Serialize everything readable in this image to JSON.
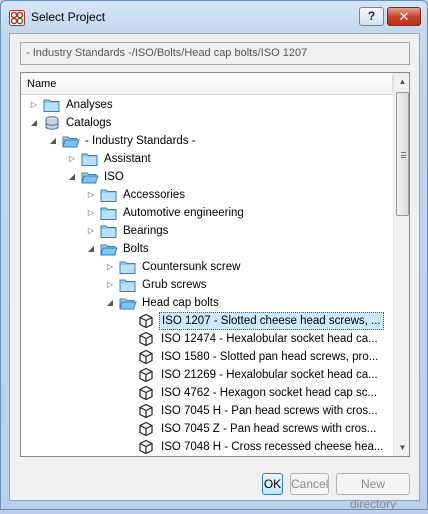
{
  "window": {
    "title": "Select Project",
    "help_label": "?",
    "close_label": "✕"
  },
  "path_field": {
    "value": "- Industry Standards -/ISO/Bolts/Head cap bolts/ISO 1207"
  },
  "tree": {
    "column_header": "Name",
    "rows": [
      {
        "label": "Analyses",
        "expander": "collapsed",
        "icon": "folder-icon"
      },
      {
        "label": "Catalogs",
        "expander": "expanded",
        "icon": "database-icon"
      },
      {
        "label": "- Industry Standards -",
        "expander": "expanded",
        "icon": "folder-open-icon"
      },
      {
        "label": "Assistant",
        "expander": "collapsed",
        "icon": "folder-icon"
      },
      {
        "label": "ISO",
        "expander": "expanded",
        "icon": "folder-open-icon"
      },
      {
        "label": "Accessories",
        "expander": "collapsed",
        "icon": "folder-icon"
      },
      {
        "label": "Automotive engineering",
        "expander": "collapsed",
        "icon": "folder-icon"
      },
      {
        "label": "Bearings",
        "expander": "collapsed",
        "icon": "folder-icon"
      },
      {
        "label": "Bolts",
        "expander": "expanded",
        "icon": "folder-open-icon"
      },
      {
        "label": "Countersunk screw",
        "expander": "collapsed",
        "icon": "folder-icon"
      },
      {
        "label": "Grub screws",
        "expander": "collapsed",
        "icon": "folder-icon"
      },
      {
        "label": "Head cap bolts",
        "expander": "expanded",
        "icon": "folder-open-icon"
      },
      {
        "label": "ISO 1207 - Slotted cheese head screws, ...",
        "expander": "none",
        "icon": "cube-icon",
        "selected": true
      },
      {
        "label": "ISO 12474 - Hexalobular socket head ca...",
        "expander": "none",
        "icon": "cube-icon"
      },
      {
        "label": "ISO 1580 - Slotted pan head screws, pro...",
        "expander": "none",
        "icon": "cube-icon"
      },
      {
        "label": "ISO 21269 - Hexalobular socket head ca...",
        "expander": "none",
        "icon": "cube-icon"
      },
      {
        "label": "ISO 4762 - Hexagon socket head cap sc...",
        "expander": "none",
        "icon": "cube-icon"
      },
      {
        "label": "ISO 7045 H - Pan head screws with cros...",
        "expander": "none",
        "icon": "cube-icon"
      },
      {
        "label": "ISO 7045 Z - Pan head screws with cros...",
        "expander": "none",
        "icon": "cube-icon"
      },
      {
        "label": "ISO 7048 H - Cross recessed cheese hea...",
        "expander": "none",
        "icon": "cube-icon"
      }
    ]
  },
  "buttons": {
    "ok": "OK",
    "cancel": "Cancel",
    "new_directory": "New directory"
  },
  "colors": {
    "folder": "#7fc4f0",
    "selection": "#cde8ff",
    "close": "#c9442c"
  }
}
